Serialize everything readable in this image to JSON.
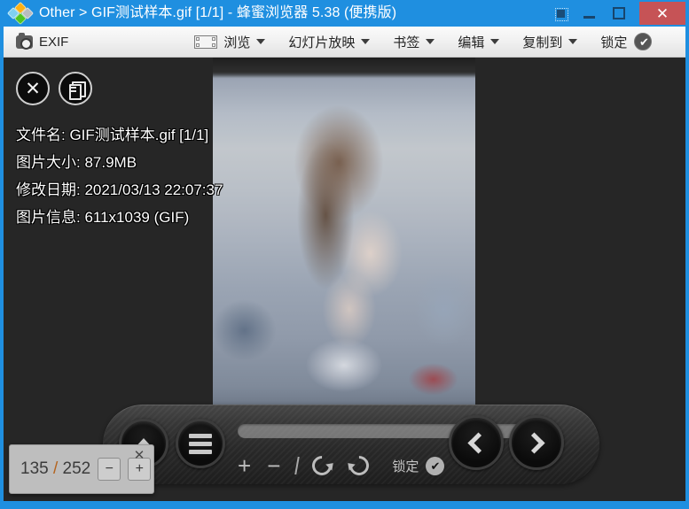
{
  "window": {
    "title": "Other > GIF测试样本.gif [1/1] - 蜂蜜浏览器 5.38 (便携版)",
    "app_icon": "honeyview-diamond-icon",
    "controls": {
      "pin": "pin-on-top-icon",
      "minimize": "minimize-icon",
      "maximize": "maximize-icon",
      "close": "✕"
    },
    "accent_color": "#1f8fe0",
    "close_color": "#c65356"
  },
  "toolbar": {
    "exif_label": "EXIF",
    "browse_label": "浏览",
    "slideshow_label": "幻灯片放映",
    "bookmark_label": "书签",
    "edit_label": "编辑",
    "copy_to_label": "复制到",
    "lock_label": "锁定"
  },
  "viewer": {
    "close_button": "✕",
    "copy_button": "copy-pages-icon",
    "info": {
      "filename": "文件名: GIF测试样本.gif [1/1]",
      "size": "图片大小: 87.9MB",
      "modified": "修改日期: 2021/03/13 22:07:37",
      "image_info": "图片信息: 611x1039 (GIF)"
    }
  },
  "bottombar": {
    "up_button": "up-arrow-icon",
    "menu_button": "hamburger-menu-icon",
    "zoom_in": "+",
    "zoom_out": "−",
    "rotate_ccw": "rotate-counterclockwise-icon",
    "rotate_cw": "rotate-clockwise-icon",
    "lock_label": "锁定",
    "prev_button": "chevron-left-icon",
    "next_button": "chevron-right-icon"
  },
  "popup": {
    "current": "135",
    "separator": "/",
    "total": "252",
    "decrease": "−",
    "increase": "+",
    "close": "✕"
  }
}
